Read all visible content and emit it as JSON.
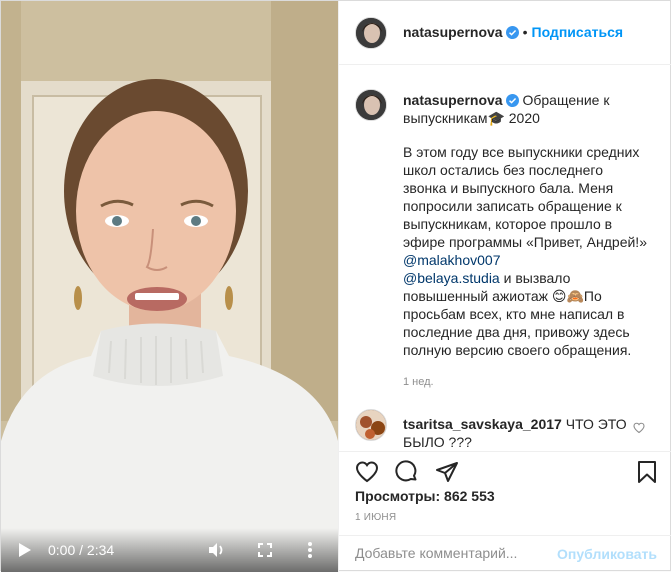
{
  "video": {
    "time_display": "0:00 / 2:34",
    "progress": 0
  },
  "header": {
    "username": "natasupernova",
    "follow_label": "Подписаться",
    "separator": "•"
  },
  "caption": {
    "username": "natasupernova",
    "title": "Обращение к выпускникам🎓 2020",
    "paragraph_text_1": "В этом году все выпускники средних школ остались без последнего звонка и выпускного бала. Меня попросили записать обращение к выпускникам, которое прошло в эфире программы «Привет, Андрей!» ",
    "mention_1": "@malakhov007",
    "mention_2": "@belaya.studia",
    "paragraph_text_2": " и вызвало повышенный ажиотаж 😊🙈По просьбам всех, кто мне написал в последние два дня, привожу здесь полную версию своего обращения.",
    "time_ago": "1 нед."
  },
  "comment": {
    "username": "tsaritsa_savskaya_2017",
    "text": " ЧТО ЭТО БЫЛО ???"
  },
  "stats": {
    "views_label": "Просмотры: 862 553",
    "date": "1 ИЮНЯ"
  },
  "add_comment": {
    "placeholder": "Добавьте комментарий...",
    "publish_label": "Опубликовать"
  },
  "colors": {
    "accent": "#0095f6",
    "publish_disabled": "#b2dffc",
    "verified": "#3897f0"
  }
}
